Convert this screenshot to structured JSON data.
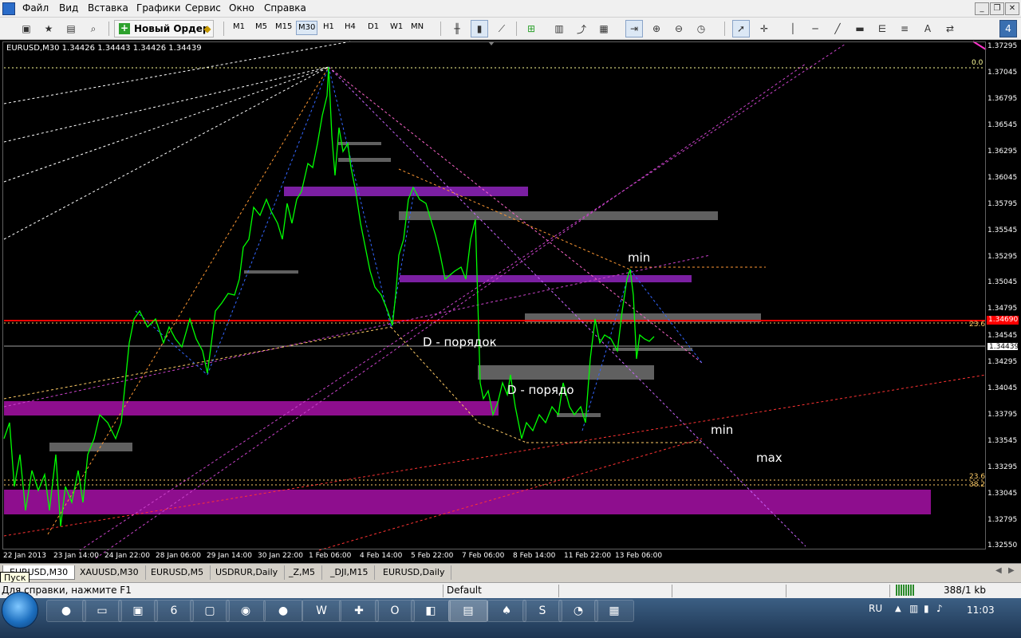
{
  "menu": [
    "Файл",
    "Вид",
    "Вставка",
    "Графики",
    "Сервис",
    "Окно",
    "Справка"
  ],
  "toolbar": {
    "new_order_label": "Новый Ордер",
    "timeframes": [
      "M1",
      "M5",
      "M15",
      "M30",
      "H1",
      "H4",
      "D1",
      "W1",
      "MN"
    ],
    "active_timeframe": "M30",
    "badge": "4"
  },
  "chart": {
    "symbol_label": "EURUSD,M30  1.34426 1.34443 1.34426 1.34439",
    "price_ticks": [
      "1.37295",
      "1.37045",
      "1.36795",
      "1.36545",
      "1.36295",
      "1.36045",
      "1.35795",
      "1.35545",
      "1.35295",
      "1.35045",
      "1.34795",
      "1.34545",
      "1.34295",
      "1.34045",
      "1.33795",
      "1.33545",
      "1.33295",
      "1.33045",
      "1.32795",
      "1.32550"
    ],
    "red_price": "1.34690",
    "current_price": "1.34439",
    "time_ticks": [
      "22 Jan 2013",
      "23 Jan 14:00",
      "24 Jan 22:00",
      "28 Jan 06:00",
      "29 Jan 14:00",
      "30 Jan 22:00",
      "1 Feb 06:00",
      "4 Feb 14:00",
      "5 Feb 22:00",
      "7 Feb 06:00",
      "8 Feb 14:00",
      "11 Feb 22:00",
      "13 Feb 06:00"
    ],
    "fib_labels": [
      "0.0",
      "23.6",
      "23.6",
      "38.2"
    ],
    "annotations": [
      "min",
      "D - порядок",
      "D - порядо",
      "min",
      "max"
    ]
  },
  "tabs": [
    "EURUSD,M30",
    "XAUUSD,M30",
    "EURUSD,M5",
    "USDRUR,Daily",
    "_Z,M5",
    "_DJI,M15",
    "EURUSD,Daily"
  ],
  "active_tab": "EURUSD,M30",
  "tooltip": "Пуск",
  "status": {
    "help": "Для справки, нажмите F1",
    "profile": "Default",
    "traffic": "388/1 kb"
  },
  "taskbar": {
    "lang": "RU",
    "time": "11:03"
  },
  "colors": {
    "price_line": "#00ff00",
    "purple_zone": "#7b1fa2",
    "magenta_zone": "#8e0e8e",
    "gray_zone": "#606060",
    "red_level": "#ff0000"
  }
}
